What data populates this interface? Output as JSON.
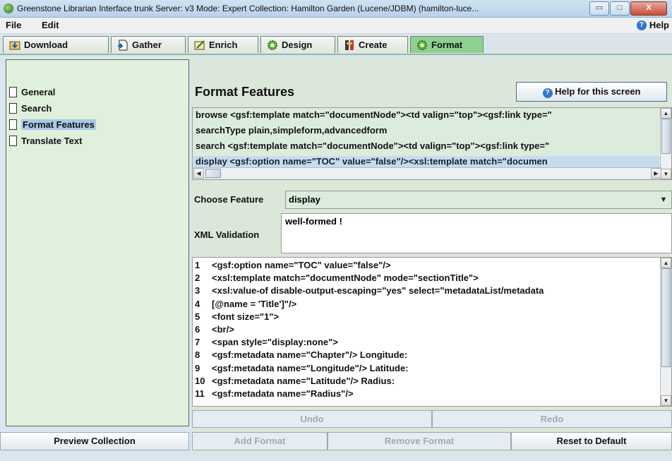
{
  "window": {
    "title": "Greenstone Librarian Interface trunk  Server: v3  Mode: Expert  Collection: Hamilton Garden (Lucene/JDBM) (hamilton-luce...",
    "minimize": "▭",
    "maximize": "□",
    "close": "X"
  },
  "menu": {
    "file": "File",
    "edit": "Edit",
    "help": "Help"
  },
  "tabs": [
    {
      "label": "Download",
      "icon": "download-icon"
    },
    {
      "label": "Gather",
      "icon": "gather-icon"
    },
    {
      "label": "Enrich",
      "icon": "enrich-icon"
    },
    {
      "label": "Design",
      "icon": "gear-icon"
    },
    {
      "label": "Create",
      "icon": "create-icon"
    },
    {
      "label": "Format",
      "icon": "gear-icon",
      "active": true
    }
  ],
  "sidebar": {
    "items": [
      {
        "label": "General"
      },
      {
        "label": "Search"
      },
      {
        "label": "Format Features",
        "selected": true
      },
      {
        "label": "Translate Text"
      }
    ],
    "preview_button": "Preview Collection"
  },
  "main": {
    "title": "Format Features",
    "help_button": "Help for this screen",
    "feature_list": [
      "browse <gsf:template match=\"documentNode\"><td valign=\"top\"><gsf:link type=\"",
      "searchType plain,simpleform,advancedform",
      "search <gsf:template match=\"documentNode\"><td valign=\"top\"><gsf:link type=\"",
      "display <gsf:option name=\"TOC\" value=\"false\"/><xsl:template match=\"documen"
    ],
    "choose_feature_label": "Choose Feature",
    "choose_feature_value": "display",
    "xml_validation_label": "XML Validation",
    "xml_validation_value": "well-formed !",
    "code_lines": [
      {
        "n": "1",
        "text": "<gsf:option name=\"TOC\" value=\"false\"/>"
      },
      {
        "n": "2",
        "text": "<xsl:template match=\"documentNode\" mode=\"sectionTitle\">"
      },
      {
        "n": "3",
        "text": "<xsl:value-of disable-output-escaping=\"yes\" select=\"metadataList/metadata"
      },
      {
        "n": "4",
        "text": "[@name = 'Title']\"/>"
      },
      {
        "n": "5",
        "text": "<font size=\"1\">"
      },
      {
        "n": "6",
        "text": "<br/>"
      },
      {
        "n": "7",
        "text": "<span style=\"display:none\">"
      },
      {
        "n": "8",
        "text": "<gsf:metadata name=\"Chapter\"/> Longitude:"
      },
      {
        "n": "9",
        "text": "<gsf:metadata name=\"Longitude\"/> Latitude:"
      },
      {
        "n": "10",
        "text": "<gsf:metadata name=\"Latitude\"/> Radius:"
      },
      {
        "n": "11",
        "text": "<gsf:metadata name=\"Radius\"/>"
      }
    ],
    "undo": "Undo",
    "redo": "Redo",
    "add_format": "Add Format",
    "remove_format": "Remove Format",
    "reset_default": "Reset to Default"
  },
  "colors": {
    "active_tab": "#8fcf92",
    "panel_green": "#dff0dc",
    "selection_blue": "#a9c9e6"
  }
}
